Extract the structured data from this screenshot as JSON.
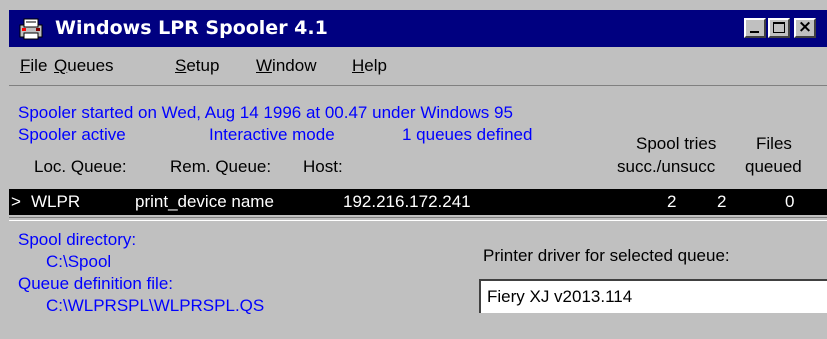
{
  "window": {
    "title": "Windows LPR Spooler 4.1",
    "controls": {
      "minimize": "minimize",
      "maximize": "maximize",
      "close": "×"
    }
  },
  "menu": [
    {
      "underline": "F",
      "rest": "ile"
    },
    {
      "underline": "Q",
      "rest": "ueues"
    },
    {
      "underline": "S",
      "rest": "etup"
    },
    {
      "underline": "W",
      "rest": "indow"
    },
    {
      "underline": "H",
      "rest": "elp"
    }
  ],
  "status": {
    "started": "Spooler started on Wed, Aug 14 1996 at 00.47 under Windows 95",
    "active": "Spooler active",
    "mode": "Interactive mode",
    "queues": "1 queues defined"
  },
  "columns": {
    "loc_queue": "Loc. Queue:",
    "rem_queue": "Rem. Queue:",
    "host": "Host:",
    "spool_tries": "Spool tries",
    "files": "Files",
    "succ_unsucc": "succ./unsucc",
    "queued": "queued"
  },
  "queue_row": {
    "marker": ">",
    "loc_queue": "WLPR",
    "rem_queue": "print_device name",
    "host": "192.216.172.241",
    "succ": "2",
    "unsucc": "2",
    "files": "0"
  },
  "details": {
    "spool_dir_label": "Spool directory:",
    "spool_dir_value": "C:\\Spool",
    "queue_def_label": "Queue definition file:",
    "queue_def_value": "C:\\WLPRSPL\\WLPRSPL.QS",
    "driver_label": "Printer driver for selected queue:",
    "driver_value": "Fiery XJ v2013.114"
  },
  "colors": {
    "titlebar": "#000080",
    "info_text": "#0000ff",
    "selected_row": "#000000",
    "window_bg": "#c0c0c0"
  }
}
